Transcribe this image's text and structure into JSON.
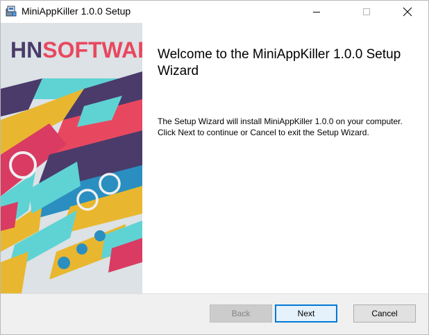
{
  "window": {
    "title": "MiniAppKiller 1.0.0 Setup"
  },
  "banner": {
    "logo_part1": "HN",
    "logo_part2": "SOFTWARE",
    "colors": {
      "logo_dark": "#4a3b6b",
      "logo_accent": "#e8485f",
      "teal": "#5fd3d3",
      "yellow": "#e8b72f",
      "magenta": "#d93b63",
      "purple": "#4a3b6b",
      "blue": "#2a8fc0"
    }
  },
  "content": {
    "title": "Welcome to the MiniAppKiller 1.0.0 Setup Wizard",
    "body": "The Setup Wizard will install MiniAppKiller 1.0.0 on your computer. Click Next to continue or Cancel to exit the Setup Wizard."
  },
  "footer": {
    "back_label": "Back",
    "next_label": "Next",
    "cancel_label": "Cancel"
  },
  "colors": {
    "focus_border": "#0078d7",
    "footer_bg": "#f0f0f0"
  }
}
